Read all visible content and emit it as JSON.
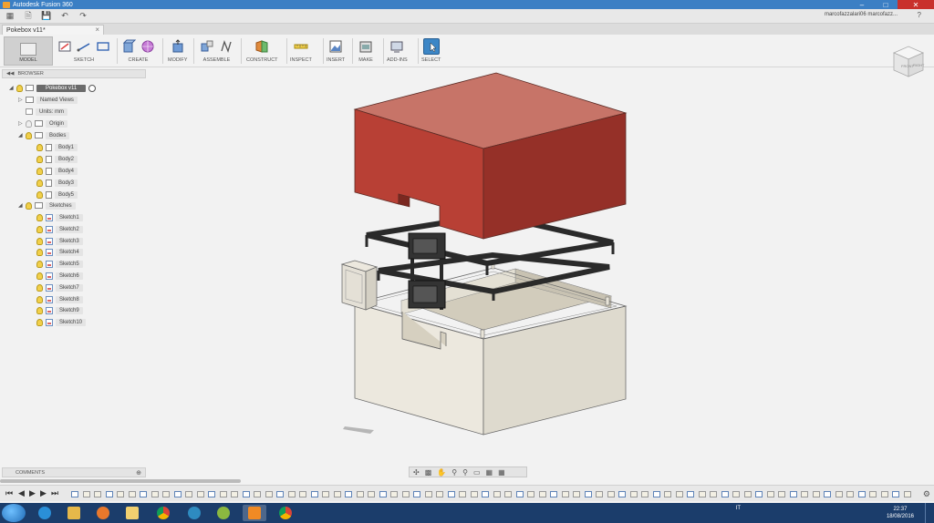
{
  "window": {
    "title": "Autodesk Fusion 360",
    "user": "marcofazzalari06 marcofazz...",
    "help": "?"
  },
  "document_tab": {
    "label": "Pokebox v11*"
  },
  "ribbon": {
    "workspace": "MODEL",
    "groups": [
      {
        "label": "SKETCH"
      },
      {
        "label": "CREATE"
      },
      {
        "label": "MODIFY"
      },
      {
        "label": "ASSEMBLE"
      },
      {
        "label": "CONSTRUCT"
      },
      {
        "label": "INSPECT"
      },
      {
        "label": "INSERT"
      },
      {
        "label": "MAKE"
      },
      {
        "label": "ADD-INS"
      },
      {
        "label": "SELECT"
      }
    ]
  },
  "viewcube": {
    "front": "FRONT",
    "right": "RIGHT"
  },
  "browser": {
    "title": "BROWSER",
    "root": "Pokebox v11",
    "named_views": "Named Views",
    "units": "Units: mm",
    "origin": "Origin",
    "bodies_label": "Bodies",
    "bodies": [
      "Body1",
      "Body2",
      "Body4",
      "Body3",
      "Body5"
    ],
    "sketches_label": "Sketches",
    "sketches": [
      "Sketch1",
      "Sketch2",
      "Sketch3",
      "Sketch4",
      "Sketch5",
      "Sketch6",
      "Sketch7",
      "Sketch8",
      "Sketch9",
      "Sketch10"
    ]
  },
  "comments": {
    "label": "COMMENTS"
  },
  "taskbar": {
    "language": "IT",
    "time": "22:37",
    "date": "18/08/2016"
  },
  "colors": {
    "lid": "#c0473a",
    "lid_front": "#b84035",
    "lid_side": "#953028",
    "frame": "#2a2a2a",
    "base_top": "#e8e4d8",
    "base_front": "#ece8de",
    "base_side": "#dcd8cc",
    "inner": "#d2ccbc"
  }
}
